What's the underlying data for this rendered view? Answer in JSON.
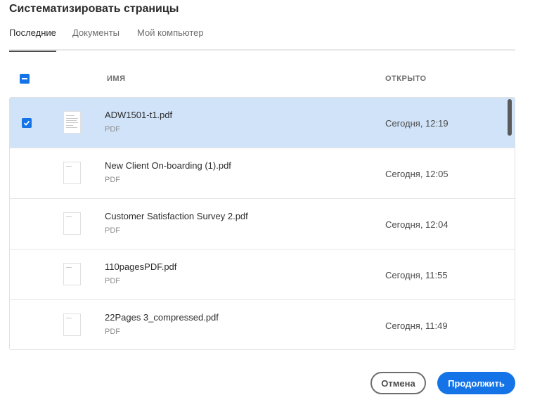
{
  "dialog": {
    "title": "Систематизировать страницы"
  },
  "tabs": [
    {
      "label": "Последние",
      "active": true
    },
    {
      "label": "Документы",
      "active": false
    },
    {
      "label": "Мой компьютер",
      "active": false
    }
  ],
  "table": {
    "col_name": "ИМЯ",
    "col_opened": "ОТКРЫТО",
    "rows": [
      {
        "name": "ADW1501-t1.pdf",
        "type": "PDF",
        "opened": "Сегодня, 12:19",
        "selected": true
      },
      {
        "name": "New Client On-boarding (1).pdf",
        "type": "PDF",
        "opened": "Сегодня, 12:05",
        "selected": false
      },
      {
        "name": "Customer Satisfaction Survey 2.pdf",
        "type": "PDF",
        "opened": "Сегодня, 12:04",
        "selected": false
      },
      {
        "name": "110pagesPDF.pdf",
        "type": "PDF",
        "opened": "Сегодня, 11:55",
        "selected": false
      },
      {
        "name": "22Pages 3_compressed.pdf",
        "type": "PDF",
        "opened": "Сегодня, 11:49",
        "selected": false
      }
    ]
  },
  "buttons": {
    "cancel": "Отмена",
    "continue": "Продолжить"
  },
  "colors": {
    "accent": "#1473e6",
    "selected_row": "#d0e3f8"
  }
}
